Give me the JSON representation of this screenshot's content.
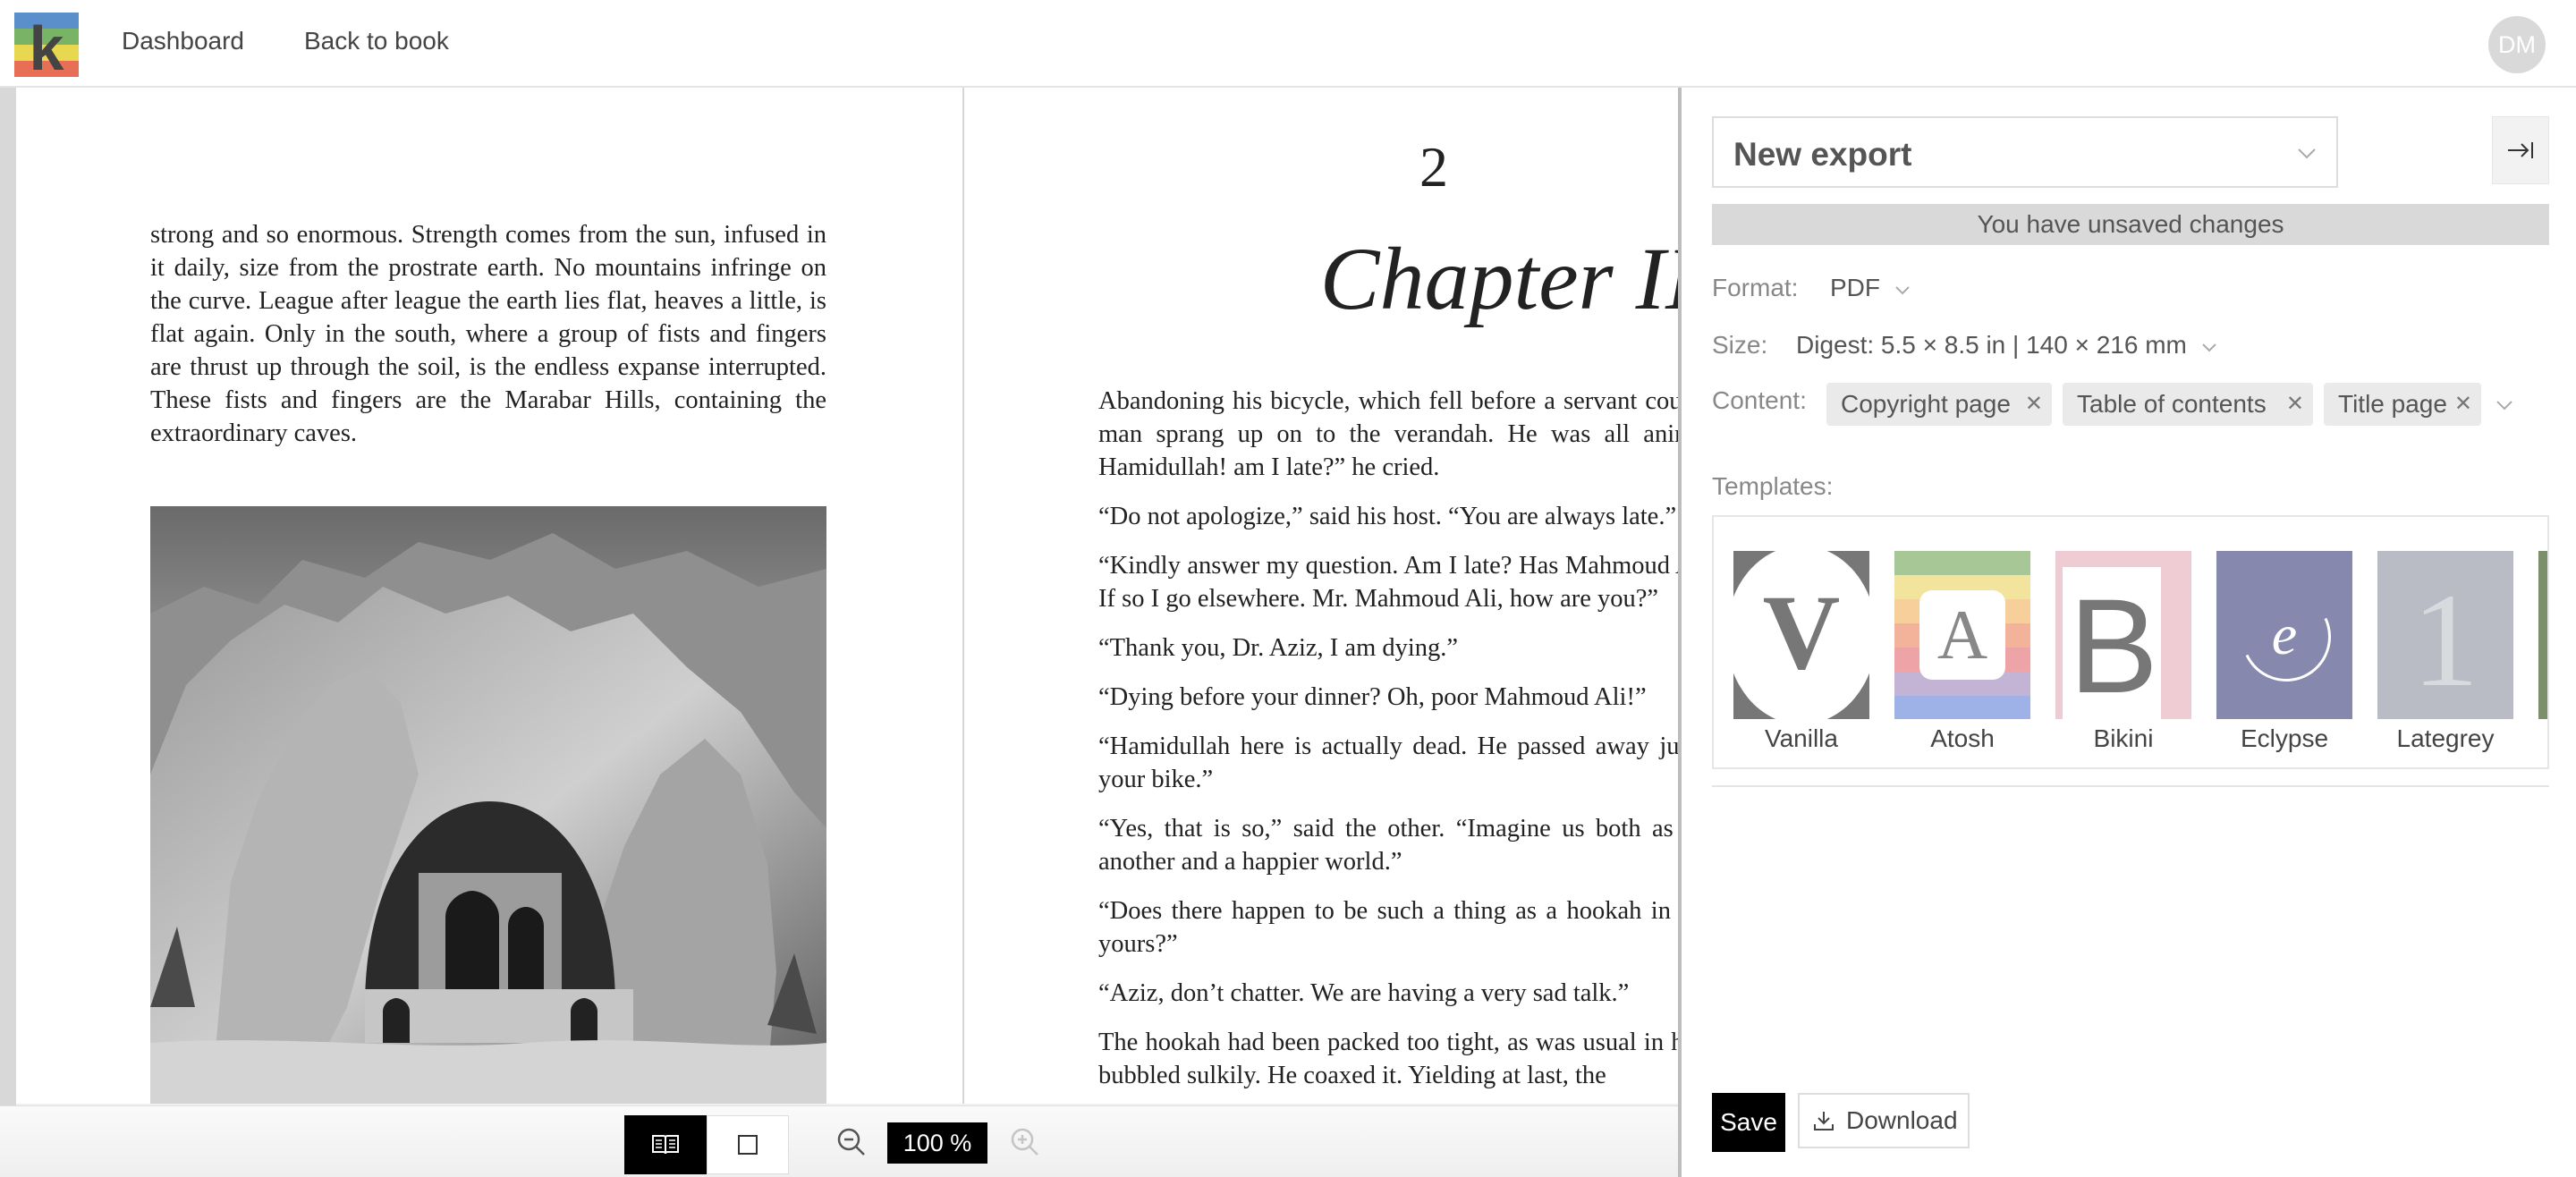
{
  "nav": {
    "logo_letter": "k",
    "dashboard": "Dashboard",
    "back_to_book": "Back to book",
    "avatar_initials": "DM"
  },
  "book": {
    "left_page_text": "strong and so enormous. Strength comes from the sun, infused in it daily, size from the prostrate earth. No mountains infringe on the curve. League after league the earth lies flat, heaves a little, is flat again. Only in the south, where a group of fists and fingers are thrust up through the soil, is the endless expanse interrupted. These fists and fingers are the Marabar Hills, containing the extraordinary caves.",
    "chapter_number": "2",
    "chapter_title": "Chapter II",
    "paragraphs": [
      "Abandoning his bicycle, which fell before a servant could catch it, the young man sprang up on to the verandah. He was all animation. “Hamidullah, Hamidullah! am I late?” he cried.",
      "“Do not apologize,” said his host. “You are always late.”",
      "“Kindly answer my question. Am I late? Has Mahmoud Ali eaten all the food? If so I go elsewhere. Mr. Mahmoud Ali, how are you?”",
      "“Thank you, Dr. Aziz, I am dying.”",
      "“Dying before your dinner? Oh, poor Mahmoud Ali!”",
      "“Hamidullah here is actually dead. He passed away just as you rode up on your bike.”",
      "“Yes, that is so,” said the other. “Imagine us both as addressing you from another and a happier world.”",
      "“Does there happen to be such a thing as a hookah in that happier world of yours?”",
      "“Aziz, don’t chatter. We are having a very sad talk.”",
      "The hookah had been packed too tight, as was usual in his friend’s house, and bubbled sulkily. He coaxed it. Yielding at last, the"
    ]
  },
  "toolbar": {
    "zoom": "100 %",
    "icons": [
      "book-spread-icon",
      "single-page-icon",
      "zoom-out-icon",
      "zoom-in-icon"
    ]
  },
  "panel": {
    "export_name": "New export",
    "unsaved": "You have unsaved changes",
    "format_label": "Format:",
    "format_value": "PDF",
    "size_label": "Size:",
    "size_value": "Digest: 5.5 × 8.5 in | 140 × 216 mm",
    "content_label": "Content:",
    "content_chips": [
      "Copyright page",
      "Table of contents",
      "Title page"
    ],
    "templates_label": "Templates:",
    "templates": [
      {
        "name": "Vanilla",
        "letter": "V"
      },
      {
        "name": "Atosh",
        "letter": "A"
      },
      {
        "name": "Bikini",
        "letter": "B"
      },
      {
        "name": "Eclypse",
        "letter": "e"
      },
      {
        "name": "Lategrey",
        "letter": "1"
      }
    ],
    "save": "Save",
    "download": "Download",
    "colors": {
      "accent": "#000000",
      "unsaved_bg": "#d9d9d9",
      "atosh_stripes": [
        "#a7c796",
        "#f3e49d",
        "#f6cf9a",
        "#f3b39a",
        "#eea3a7",
        "#c3b4d6",
        "#9fb2e8"
      ],
      "bikini_bg": "#efcbd3",
      "eclypse_bg": "#8688ad",
      "lategrey_bg": "#b9bcc5"
    }
  }
}
